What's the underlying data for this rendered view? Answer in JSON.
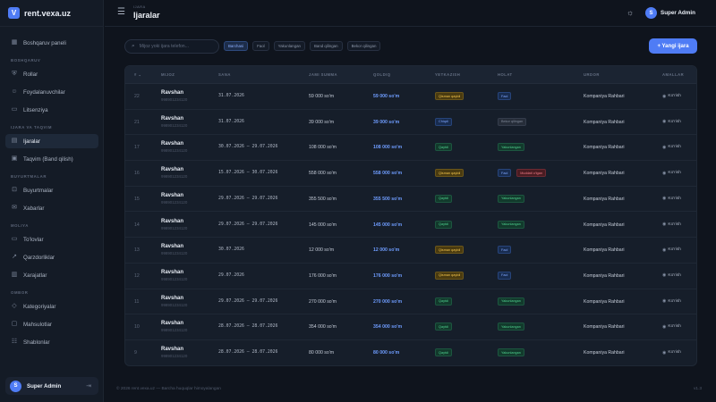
{
  "brand": {
    "name": "rent.vexa.uz",
    "logo": "V"
  },
  "sidebar": {
    "sections": [
      {
        "label": "",
        "items": [
          {
            "label": "Boshqaruv paneli",
            "icon": "dashboard-icon"
          }
        ]
      },
      {
        "label": "BOSHQARUV",
        "items": [
          {
            "label": "Rollar",
            "icon": "shield-icon"
          },
          {
            "label": "Foydalanuvchilar",
            "icon": "users-icon"
          },
          {
            "label": "Litsenziya",
            "icon": "license-icon"
          }
        ]
      },
      {
        "label": "IJARA VA TAQVIM",
        "items": [
          {
            "label": "Ijaralar",
            "icon": "document-icon",
            "active": true
          },
          {
            "label": "Taqvim (Band qilish)",
            "icon": "calendar-icon"
          }
        ]
      },
      {
        "label": "BUYURTMALAR",
        "items": [
          {
            "label": "Buyurtmalar",
            "icon": "cart-icon"
          },
          {
            "label": "Xabarlar",
            "icon": "mail-icon"
          }
        ]
      },
      {
        "label": "MOLIYA",
        "items": [
          {
            "label": "To'lovlar",
            "icon": "wallet-icon"
          },
          {
            "label": "Qarzdorliklar",
            "icon": "chart-icon"
          },
          {
            "label": "Xarajatlar",
            "icon": "expense-icon"
          }
        ]
      },
      {
        "label": "OMBOR",
        "items": [
          {
            "label": "Kategoriyalar",
            "icon": "category-icon"
          },
          {
            "label": "Mahsulotlar",
            "icon": "box-icon"
          },
          {
            "label": "Shablonlar",
            "icon": "template-icon"
          }
        ]
      }
    ],
    "user": {
      "name": "Super Admin",
      "initial": "S"
    }
  },
  "header": {
    "breadcrumb": "IJARA",
    "title": "Ijaralar",
    "user": "Super Admin",
    "user_initial": "S"
  },
  "toolbar": {
    "search_placeholder": "Mijoz yoki ijara telefon...",
    "filters": [
      "Barchasi",
      "Faol",
      "Yakunlangan",
      "Band qilingan",
      "Bekor qilingan"
    ],
    "add_label": "+ Yangi ijara"
  },
  "table": {
    "headers": [
      "# ⌄",
      "MIJOZ",
      "SANA",
      "JAMI SUMMA",
      "QOLDIQ",
      "YETKAZISH",
      "HOLAT",
      "URDOR",
      "AMALLAR"
    ],
    "rows": [
      {
        "id": "22",
        "name": "Ravshan",
        "phone": "998901234120",
        "date": "31.07.2026",
        "total": "59 000 so'm",
        "remaining": "59 000 so'm",
        "delivery": {
          "label": "Qisman qaytdi",
          "tone": "yellow"
        },
        "status": [
          {
            "label": "Faol",
            "tone": "blue"
          }
        ],
        "owner": "Kompaniya Rahbari",
        "action": "Ko'rish"
      },
      {
        "id": "21",
        "name": "Ravshan",
        "phone": "998901234120",
        "date": "31.07.2026",
        "total": "39 000 so'm",
        "remaining": "39 000 so'm",
        "delivery": {
          "label": "Chiqdi",
          "tone": "blue"
        },
        "status": [
          {
            "label": "Bekor qilingan",
            "tone": "gray"
          }
        ],
        "owner": "Kompaniya Rahbari",
        "action": "Ko'rish"
      },
      {
        "id": "17",
        "name": "Ravshan",
        "phone": "998901234120",
        "date": "30.07.2026 – 29.07.2026",
        "total": "108 000 so'm",
        "remaining": "108 000 so'm",
        "delivery": {
          "label": "Qaytdi",
          "tone": "green"
        },
        "status": [
          {
            "label": "Yakunlangan",
            "tone": "green"
          }
        ],
        "owner": "Kompaniya Rahbari",
        "action": "Ko'rish"
      },
      {
        "id": "16",
        "name": "Ravshan",
        "phone": "998901234120",
        "date": "15.07.2026 – 30.07.2026",
        "total": "558 000 so'm",
        "remaining": "558 000 so'm",
        "delivery": {
          "label": "Qisman qaytdi",
          "tone": "yellow"
        },
        "status": [
          {
            "label": "Faol",
            "tone": "blue"
          },
          {
            "label": "Muddati o'tgan",
            "tone": "red"
          }
        ],
        "owner": "Kompaniya Rahbari",
        "action": "Ko'rish"
      },
      {
        "id": "15",
        "name": "Ravshan",
        "phone": "998901234120",
        "date": "29.07.2026 – 29.07.2026",
        "total": "355 500 so'm",
        "remaining": "355 500 so'm",
        "delivery": {
          "label": "Qaytdi",
          "tone": "green"
        },
        "status": [
          {
            "label": "Yakunlangan",
            "tone": "green"
          }
        ],
        "owner": "Kompaniya Rahbari",
        "action": "Ko'rish"
      },
      {
        "id": "14",
        "name": "Ravshan",
        "phone": "998901234120",
        "date": "29.07.2026 – 29.07.2026",
        "total": "145 000 so'm",
        "remaining": "145 000 so'm",
        "delivery": {
          "label": "Qaytdi",
          "tone": "green"
        },
        "status": [
          {
            "label": "Yakunlangan",
            "tone": "green"
          }
        ],
        "owner": "Kompaniya Rahbari",
        "action": "Ko'rish"
      },
      {
        "id": "13",
        "name": "Ravshan",
        "phone": "998901234120",
        "date": "30.07.2026",
        "total": "12 000 so'm",
        "remaining": "12 000 so'm",
        "delivery": {
          "label": "Qisman qaytdi",
          "tone": "yellow"
        },
        "status": [
          {
            "label": "Faol",
            "tone": "blue"
          }
        ],
        "owner": "Kompaniya Rahbari",
        "action": "Ko'rish"
      },
      {
        "id": "12",
        "name": "Ravshan",
        "phone": "998901234120",
        "date": "29.07.2026",
        "total": "176 000 so'm",
        "remaining": "176 000 so'm",
        "delivery": {
          "label": "Qisman qaytdi",
          "tone": "yellow"
        },
        "status": [
          {
            "label": "Faol",
            "tone": "blue"
          }
        ],
        "owner": "Kompaniya Rahbari",
        "action": "Ko'rish"
      },
      {
        "id": "11",
        "name": "Ravshan",
        "phone": "998901234120",
        "date": "29.07.2026 – 29.07.2026",
        "total": "270 000 so'm",
        "remaining": "270 000 so'm",
        "delivery": {
          "label": "Qaytdi",
          "tone": "green"
        },
        "status": [
          {
            "label": "Yakunlangan",
            "tone": "green"
          }
        ],
        "owner": "Kompaniya Rahbari",
        "action": "Ko'rish"
      },
      {
        "id": "10",
        "name": "Ravshan",
        "phone": "998901234120",
        "date": "28.07.2026 – 28.07.2026",
        "total": "354 000 so'm",
        "remaining": "354 000 so'm",
        "delivery": {
          "label": "Qaytdi",
          "tone": "green"
        },
        "status": [
          {
            "label": "Yakunlangan",
            "tone": "green"
          }
        ],
        "owner": "Kompaniya Rahbari",
        "action": "Ko'rish"
      },
      {
        "id": "9",
        "name": "Ravshan",
        "phone": "998901234120",
        "date": "28.07.2026 – 28.07.2026",
        "total": "80 000 so'm",
        "remaining": "80 000 so'm",
        "delivery": {
          "label": "Qaytdi",
          "tone": "green"
        },
        "status": [
          {
            "label": "Yakunlangan",
            "tone": "green"
          }
        ],
        "owner": "Kompaniya Rahbari",
        "action": "Ko'rish"
      }
    ]
  },
  "footer": {
    "copyright": "© 2026 rent.vexa.uz — Barcha huquqlar himoyalangan",
    "version": "v1.3"
  }
}
